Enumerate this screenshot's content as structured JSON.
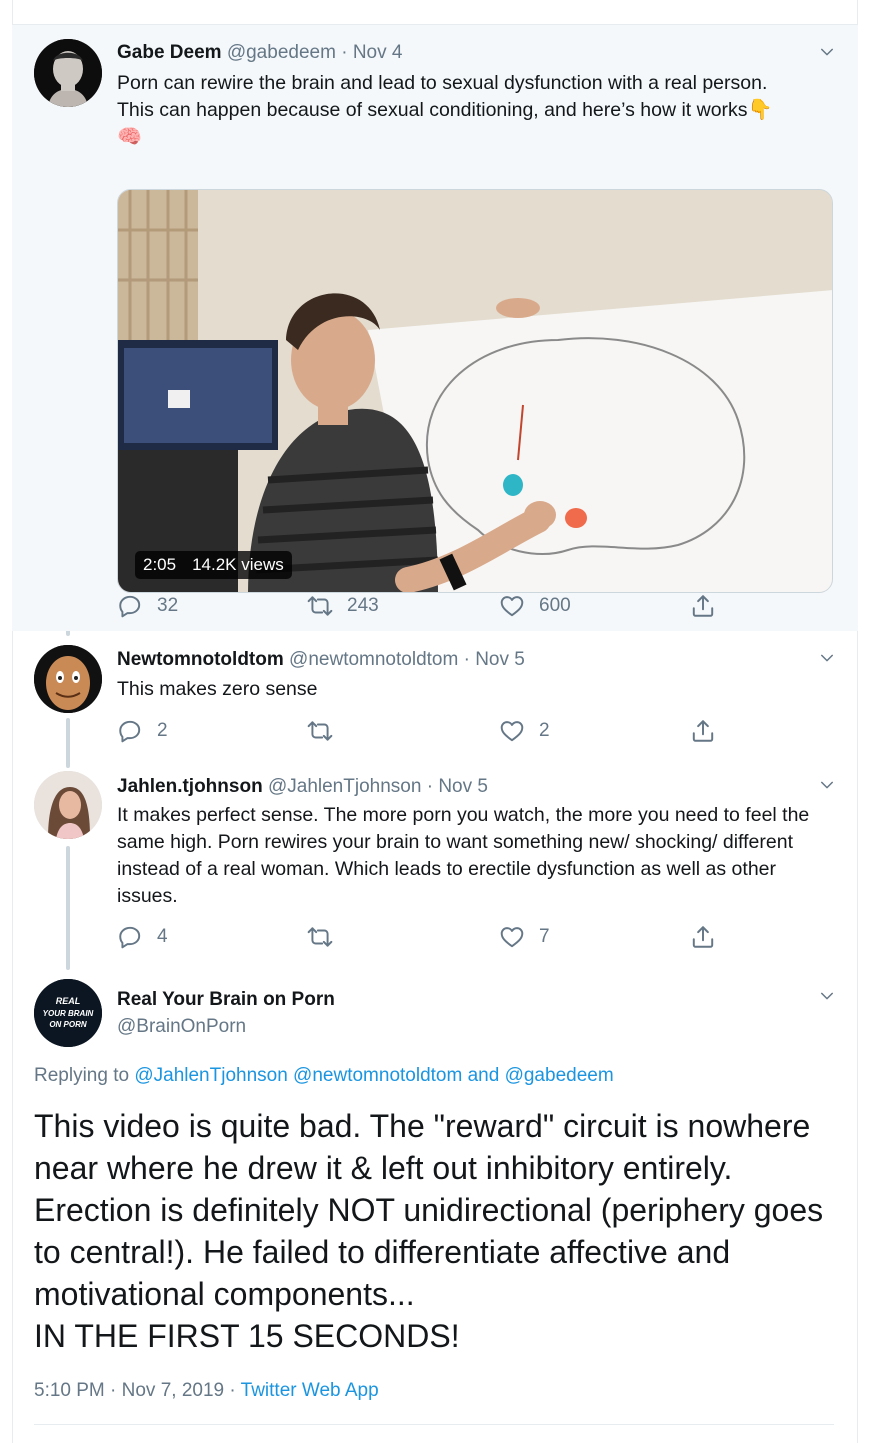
{
  "tweets": [
    {
      "name": "Gabe Deem",
      "handle": "@gabedeem",
      "dot": "·",
      "date": "Nov 4",
      "text_line1": "Porn can rewire the brain and lead to sexual dysfunction with a real person.",
      "text_line2": "This can happen because of sexual conditioning, and here’s how it works",
      "emoji_point": "👇",
      "emoji_brain": "🧠",
      "video": {
        "duration": "2:05",
        "views": "14.2K views"
      },
      "replies": "32",
      "retweets": "243",
      "likes": "600"
    },
    {
      "name": "Newtomnotoldtom",
      "handle": "@newtomnotoldtom",
      "dot": "·",
      "date": "Nov 5",
      "text": "This makes zero sense",
      "replies": "2",
      "retweets": "",
      "likes": "2"
    },
    {
      "name": "Jahlen.tjohnson",
      "handle": "@JahlenTjohnson",
      "dot": "·",
      "date": "Nov 5",
      "text": "It makes perfect sense. The more porn you watch, the more you need to feel the same high. Porn rewires your brain to want something new/ shocking/ different instead of a real woman. Which leads to erectile dysfunction as well as other issues.",
      "replies": "4",
      "retweets": "",
      "likes": "7"
    }
  ],
  "main": {
    "name": "Real Your Brain on Porn",
    "handle": "@BrainOnPorn",
    "avatar_text": [
      "REAL",
      "YOUR BRAIN",
      "ON PORN"
    ],
    "replying_label": "Replying to",
    "replying_to": "@JahlenTjohnson @newtomnotoldtom and @gabedeem",
    "text": "This video is quite bad. The \"reward\" circuit is nowhere near where he drew it & left out inhibitory entirely. Erection is definitely NOT unidirectional (periphery goes to central!). He failed to differentiate affective and motivational components...\nIN THE FIRST 15 SECONDS!",
    "timestamp": "5:10 PM · Nov 7, 2019 ·",
    "source": "Twitter Web App"
  },
  "colors": {
    "accent": "#1b95e0",
    "muted": "#657786",
    "border": "#e6ecf0",
    "highlight_bg": "#f5f8fa"
  },
  "icons": [
    "reply-icon",
    "retweet-icon",
    "like-icon",
    "share-icon",
    "chevron-down-icon"
  ]
}
